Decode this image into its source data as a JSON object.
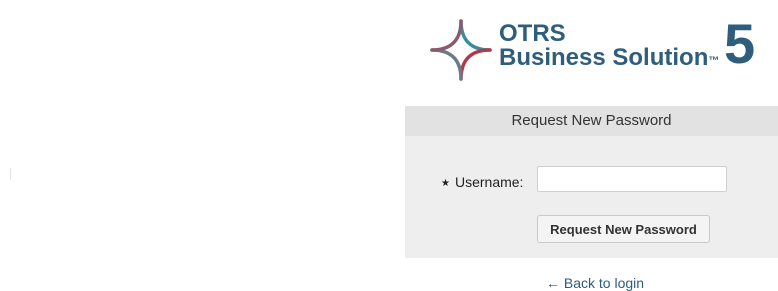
{
  "logo": {
    "line1": "OTRS",
    "line2": "Business Solution",
    "trademark": "™",
    "version": "5",
    "icon": "otrs-star-icon",
    "brand_color": "#2f5d7c",
    "mark_colors": [
      "#3b8c99",
      "#b23a48",
      "#6b7a8a"
    ]
  },
  "form": {
    "title": "Request New Password",
    "required_marker": "★",
    "username_label": "Username:",
    "username_value": "",
    "submit_label": "Request New Password",
    "panel_bg": "#eeeeee",
    "header_bg": "#e2e2e2"
  },
  "footer": {
    "back_link": "← Back to login"
  }
}
